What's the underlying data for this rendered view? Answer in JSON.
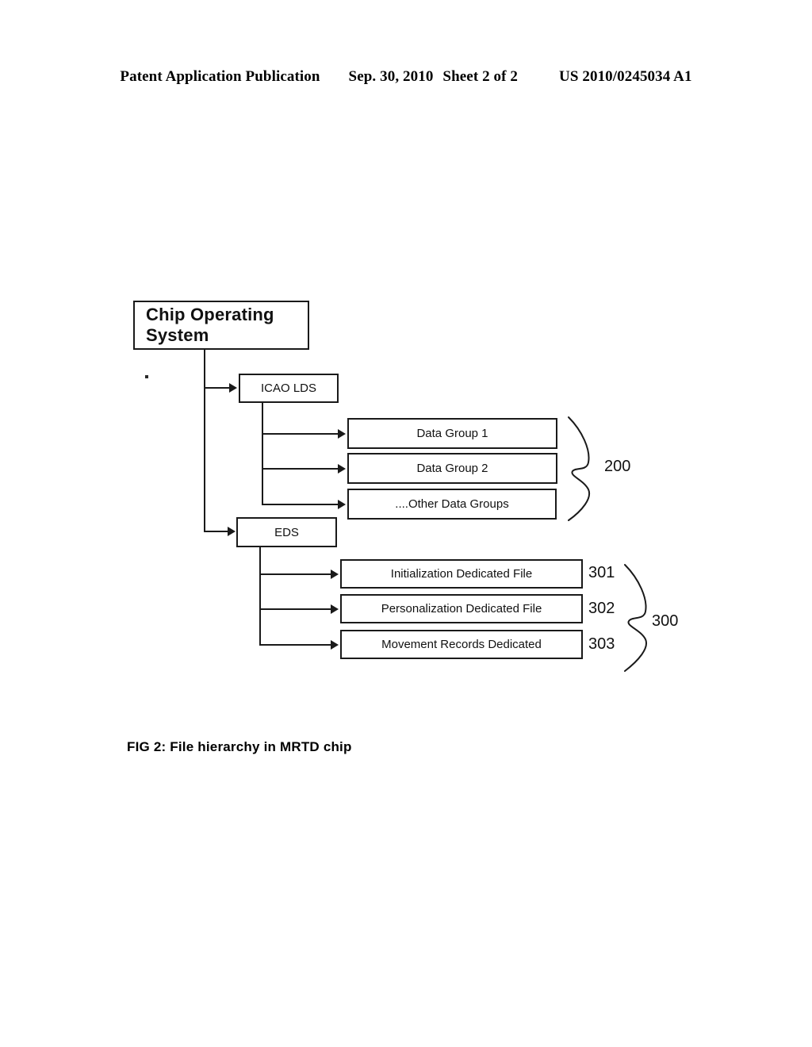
{
  "header": {
    "publication": "Patent Application Publication",
    "date": "Sep. 30, 2010",
    "sheet": "Sheet 2 of 2",
    "patent_number": "US 2010/0245034 A1"
  },
  "figure": {
    "caption": "FIG 2: File hierarchy in MRTD chip",
    "root": {
      "label": "Chip Operating System"
    },
    "branches": [
      {
        "label": "ICAO LDS",
        "group_ref": "200",
        "children": [
          {
            "label": "Data Group 1",
            "ref": ""
          },
          {
            "label": "Data Group 2",
            "ref": ""
          },
          {
            "label": "....Other Data Groups",
            "ref": ""
          }
        ]
      },
      {
        "label": "EDS",
        "group_ref": "300",
        "children": [
          {
            "label": "Initialization Dedicated File",
            "ref": "301"
          },
          {
            "label": "Personalization Dedicated File",
            "ref": "302"
          },
          {
            "label": "Movement Records Dedicated",
            "ref": "303"
          }
        ]
      }
    ]
  },
  "colors": {
    "ink": "#1a1a1a",
    "page": "#ffffff"
  }
}
